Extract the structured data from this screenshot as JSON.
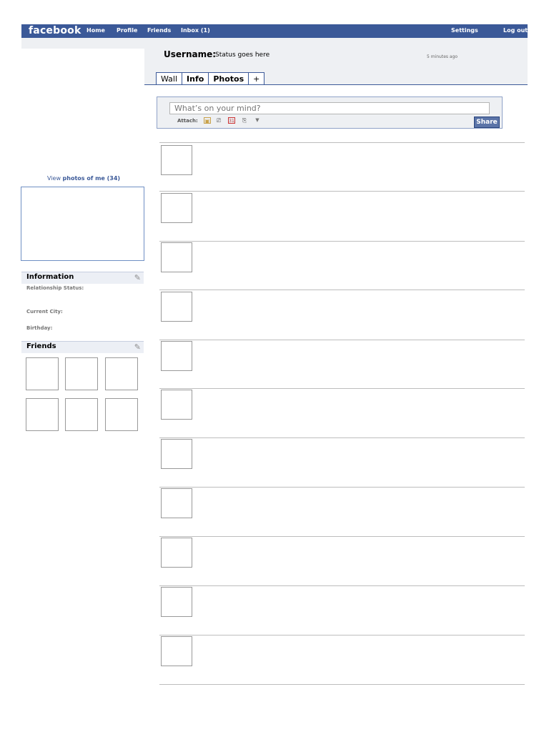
{
  "nav": {
    "logo": "facebook",
    "home": "Home",
    "profile": "Profile",
    "friends": "Friends",
    "inbox": "Inbox (1)",
    "settings": "Settings",
    "logout": "Log out"
  },
  "header": {
    "username": "Username:",
    "status": "Status goes here",
    "time": "5 minutes ago"
  },
  "tabs": [
    "Wall",
    "Info",
    "Photos",
    "+"
  ],
  "publisher": {
    "placeholder": "What’s on your mind?",
    "attach_label": "Attach:",
    "share_label": "Share"
  },
  "left": {
    "view_photos_prefix": "View",
    "view_photos_bold": "photos of me (34)",
    "information_title": "Information",
    "relationship_label": "Relationship Status:",
    "city_label": "Current City:",
    "birthday_label": "Birthday:",
    "friends_title": "Friends"
  },
  "colors": {
    "brand": "#3b5998",
    "band": "#eef0f3"
  },
  "icons": [
    "photo-icon",
    "video-icon",
    "event-icon",
    "link-icon",
    "more-icon",
    "pencil-icon"
  ]
}
